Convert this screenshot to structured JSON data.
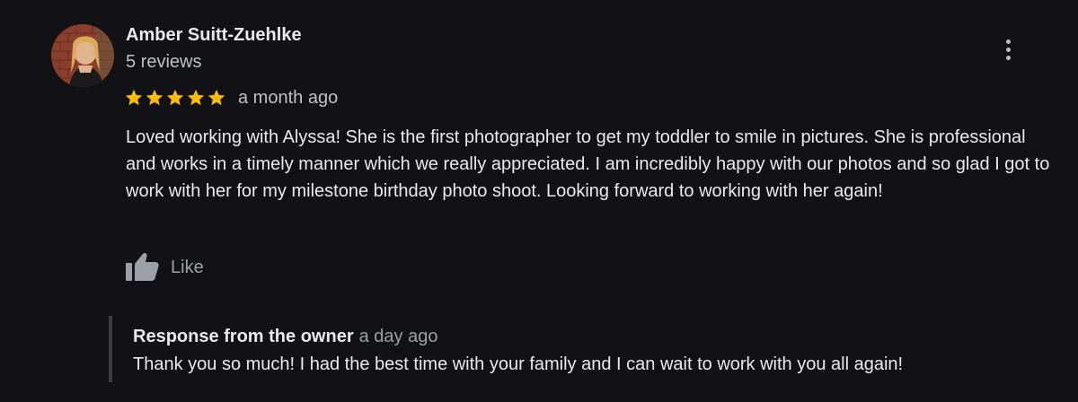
{
  "review": {
    "reviewer_name": "Amber Suitt-Zuehlke",
    "review_count": "5 reviews",
    "rating": 5,
    "rating_max": 5,
    "star_color": "#fbbc04",
    "date": "a month ago",
    "text": "Loved working with Alyssa! She is the first photographer to get my toddler to smile in pictures. She is professional and works in a timely manner which we really appreciated. I am incredibly happy with our photos and so glad I got to work with her for my milestone birthday photo shoot. Looking forward to working with her again!",
    "like_label": "Like",
    "icons": {
      "more": "more-vertical-icon",
      "like": "thumbs-up-icon",
      "star": "star-icon"
    }
  },
  "owner_response": {
    "label": "Response from the owner",
    "date": "a day ago",
    "text": "Thank you so much! I had the best time with your family and I can wait to work with you all again!"
  },
  "theme": {
    "background": "#121216",
    "text_primary": "#e8eaed",
    "text_secondary": "#bdc1c6",
    "muted": "#9aa0a6"
  }
}
